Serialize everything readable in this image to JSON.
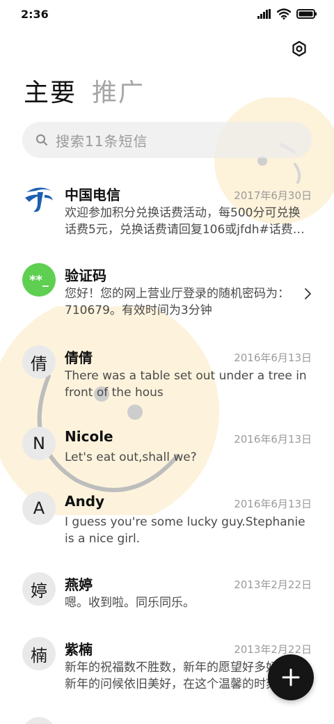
{
  "status_bar": {
    "time": "2:36",
    "icons": [
      "signal-icon",
      "wifi-icon",
      "battery-icon"
    ]
  },
  "header": {
    "settings_icon": "settings-icon",
    "tabs": [
      {
        "label": "主要",
        "active": true
      },
      {
        "label": "推广",
        "active": false
      }
    ]
  },
  "search": {
    "placeholder": "搜索11条短信"
  },
  "conversations": [
    {
      "avatar_type": "logo",
      "avatar_text": "",
      "name": "中国电信",
      "date": "2017年6月30日",
      "preview": "欢迎参加积分兑换话费活动，每500分可兑换话费5元，兑换话费请回复106或jfdh#话费…"
    },
    {
      "avatar_type": "code",
      "avatar_text": "**_",
      "name": "验证码",
      "date": "",
      "preview": "您好！您的网上营业厅登录的随机密码为：710679。有效时间为3分钟"
    },
    {
      "avatar_type": "letter",
      "avatar_text": "倩",
      "name": "倩倩",
      "date": "2016年6月13日",
      "preview": "There was a table set out under a tree in front of the hous"
    },
    {
      "avatar_type": "letter",
      "avatar_text": "N",
      "name": "Nicole",
      "date": "2016年6月13日",
      "preview": "Let's eat out,shall we?"
    },
    {
      "avatar_type": "letter",
      "avatar_text": "A",
      "name": "Andy",
      "date": "2016年6月13日",
      "preview": "I guess you're some lucky guy.Stephanie is a nice girl."
    },
    {
      "avatar_type": "letter",
      "avatar_text": "婷",
      "name": "燕婷",
      "date": "2013年2月22日",
      "preview": "嗯。收到啦。同乐同乐。"
    },
    {
      "avatar_type": "letter",
      "avatar_text": "楠",
      "name": "紫楠",
      "date": "2013年2月22日",
      "preview": "新年的祝福数不胜数，新年的愿望好多好多，新年的问候依旧美好，在这个温馨的时刻"
    },
    {
      "avatar_type": "letter",
      "avatar_text": "",
      "name": "",
      "date": "",
      "preview": ""
    }
  ],
  "fab": {
    "icon": "plus-icon"
  },
  "colors": {
    "accent_dark": "#151515",
    "code_avatar_green": "#5fcf52",
    "telecom_blue": "#1d5fb0",
    "deco_yellow": "#fdf1d6"
  }
}
